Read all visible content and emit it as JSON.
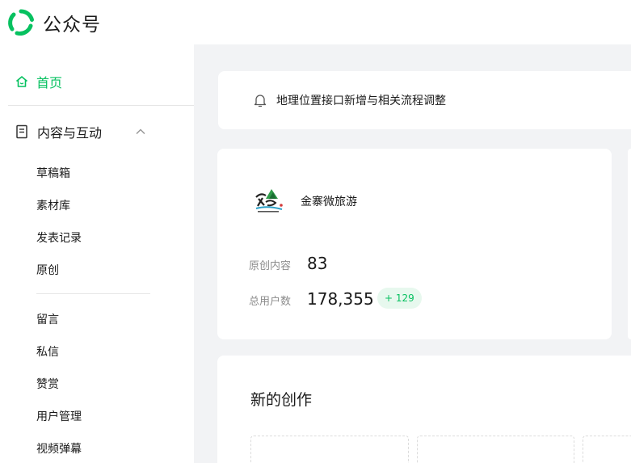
{
  "header": {
    "title": "公众号",
    "logo_color": "#07c160"
  },
  "sidebar": {
    "home": {
      "label": "首页",
      "icon": "home-icon",
      "active": true,
      "color": "#07c160"
    },
    "content_group": {
      "label": "内容与互动",
      "icon": "document-icon",
      "expanded": true,
      "items": [
        {
          "label": "草稿箱"
        },
        {
          "label": "素材库"
        },
        {
          "label": "发表记录"
        },
        {
          "label": "原创"
        },
        {
          "label": "留言"
        },
        {
          "label": "私信"
        },
        {
          "label": "赞赏"
        },
        {
          "label": "用户管理"
        },
        {
          "label": "视频弹幕"
        }
      ]
    }
  },
  "notice": {
    "icon": "bell-icon",
    "text": "地理位置接口新增与相关流程调整"
  },
  "account": {
    "name": "金寨微旅游",
    "stats": {
      "original_label": "原创内容",
      "original_value": "83",
      "users_label": "总用户数",
      "users_value": "178,355",
      "users_delta": "+ 129"
    }
  },
  "create": {
    "title": "新的创作"
  },
  "colors": {
    "accent": "#07c160",
    "page_bg": "#f2f3f5",
    "badge_bg": "#e7f8ee"
  }
}
